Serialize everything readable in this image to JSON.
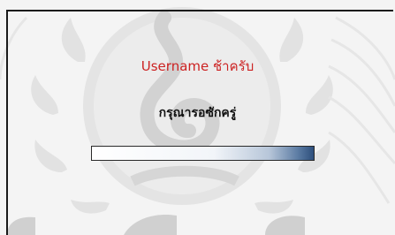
{
  "dialog": {
    "title": "Username ช้าครับ",
    "message": "กรุณารอซักครู่",
    "progress": 1.0,
    "colors": {
      "title": "#cc2222",
      "message": "#111111",
      "progress_end": "#2d4f7c"
    }
  },
  "background": {
    "watermark_icon": "university-seal-watermark"
  }
}
